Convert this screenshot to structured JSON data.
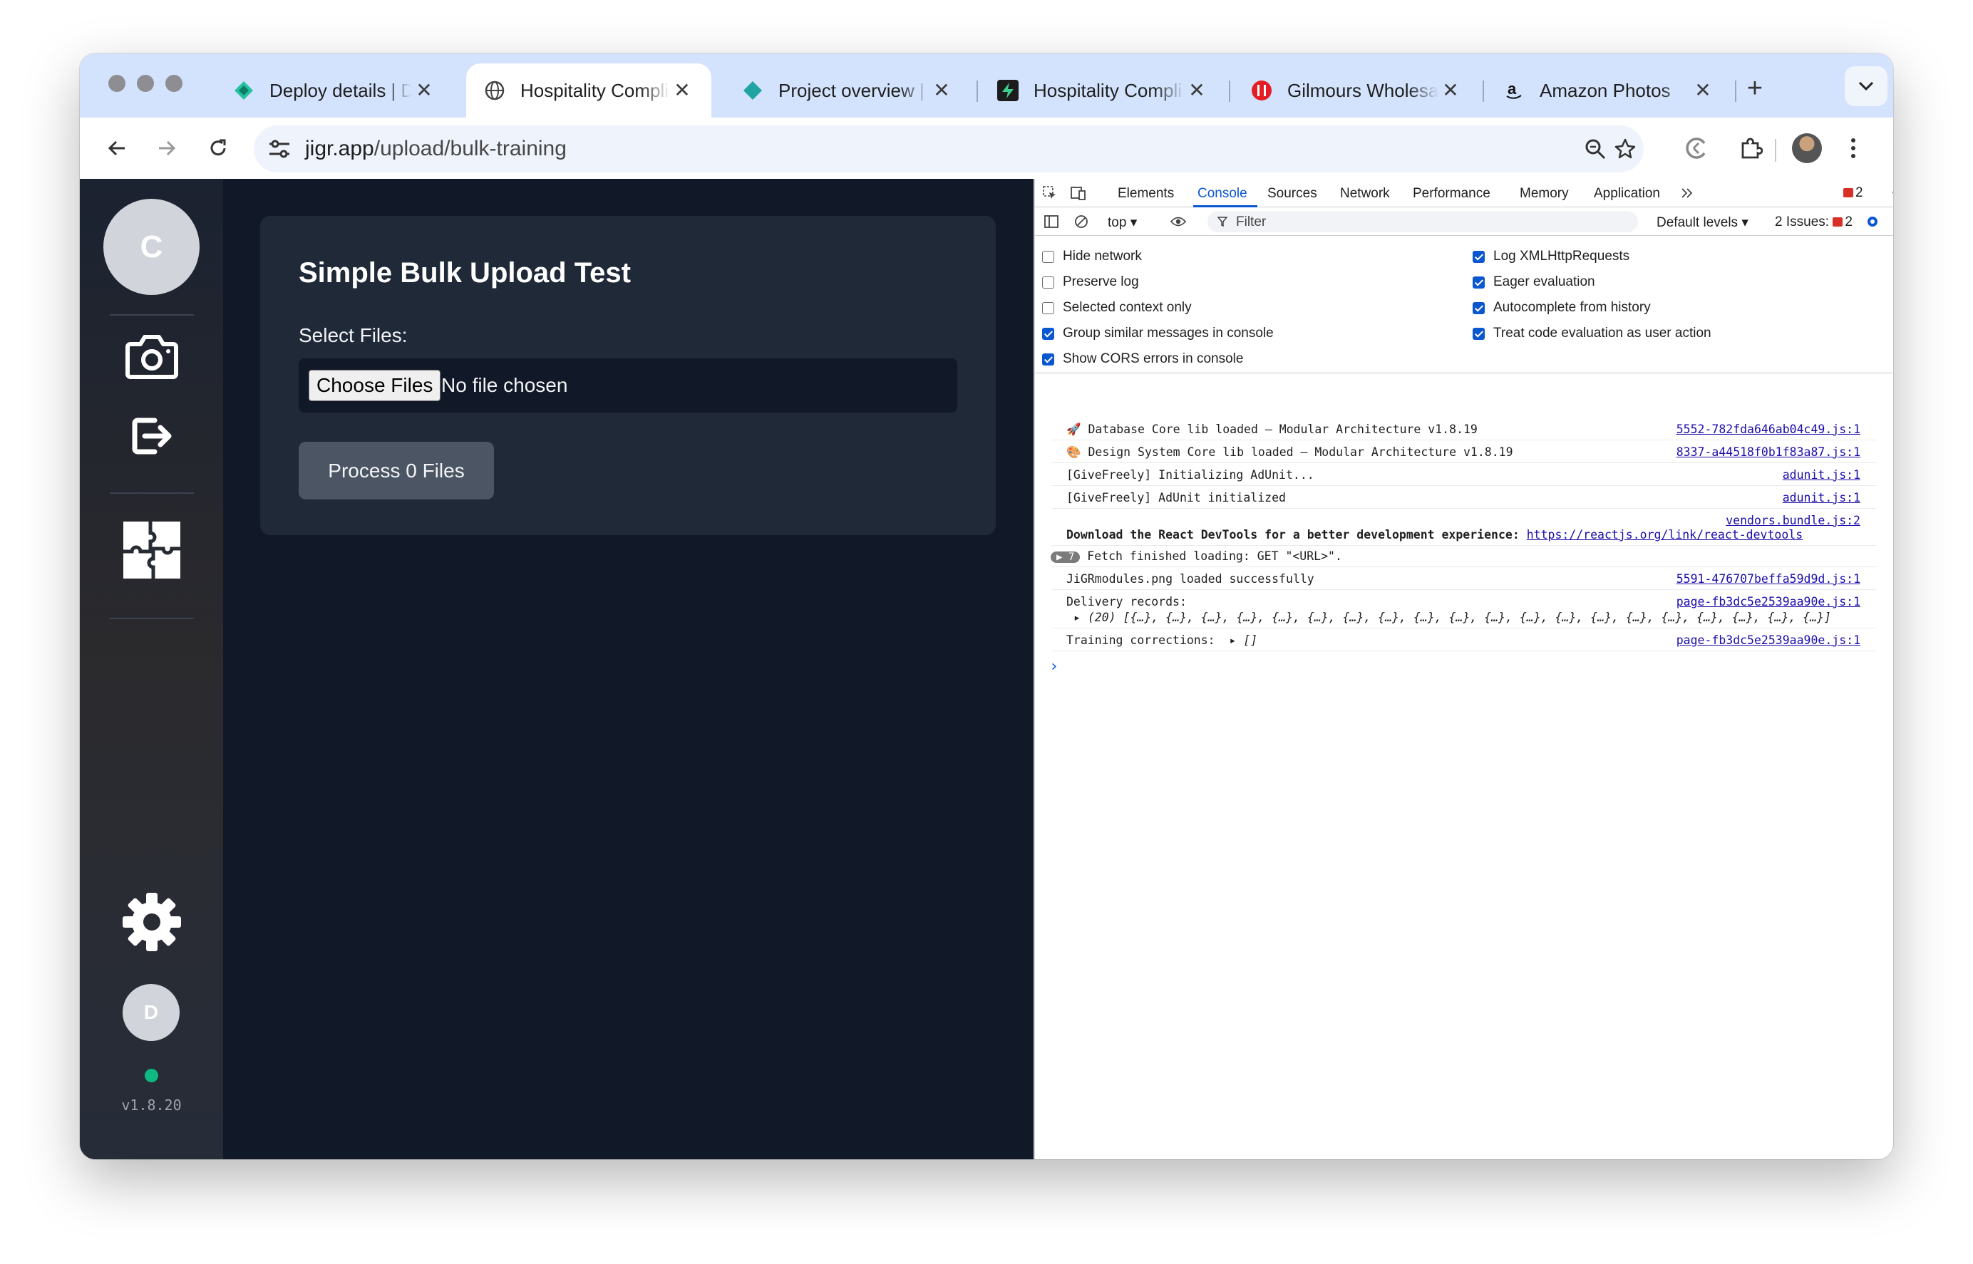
{
  "browser": {
    "tabs": [
      {
        "title": "Deploy details | De",
        "favicon": "netlify-icon"
      },
      {
        "title": "Hospitality Compli",
        "favicon": "globe-icon",
        "active": true
      },
      {
        "title": "Project overview | ",
        "favicon": "diamond-icon"
      },
      {
        "title": "Hospitality Compli",
        "favicon": "supabase-icon"
      },
      {
        "title": "Gilmours Wholesal",
        "favicon": "gilmours-icon"
      },
      {
        "title": "Amazon Photos",
        "favicon": "amazon-icon"
      }
    ],
    "url_host": "jigr.app",
    "url_path": "/upload/bulk-training"
  },
  "sidebar": {
    "avatar_initial": "C",
    "user_initial": "D",
    "version": "v1.8.20",
    "icons": [
      "camera-icon",
      "logout-icon",
      "puzzle-icon",
      "gear-icon"
    ],
    "status_color": "#10b981"
  },
  "main": {
    "title": "Simple Bulk Upload Test",
    "select_label": "Select Files:",
    "choose_button": "Choose Files",
    "no_file": "No file chosen",
    "process_button": "Process 0 Files"
  },
  "devtools": {
    "tabs": [
      "Elements",
      "Console",
      "Sources",
      "Network",
      "Performance",
      "Memory",
      "Application"
    ],
    "active_tab": "Console",
    "error_count": "2",
    "context": "top",
    "filter_placeholder": "Filter",
    "levels": "Default levels",
    "issues_label": "2 Issues:",
    "issues_count": "2",
    "options_left": [
      {
        "label": "Hide network",
        "checked": false
      },
      {
        "label": "Preserve log",
        "checked": false
      },
      {
        "label": "Selected context only",
        "checked": false
      },
      {
        "label": "Group similar messages in console",
        "checked": true
      },
      {
        "label": "Show CORS errors in console",
        "checked": true
      }
    ],
    "options_right": [
      {
        "label": "Log XMLHttpRequests",
        "checked": true
      },
      {
        "label": "Eager evaluation",
        "checked": true
      },
      {
        "label": "Autocomplete from history",
        "checked": true
      },
      {
        "label": "Treat code evaluation as user action",
        "checked": true
      }
    ],
    "logs": [
      {
        "msg": "🚀 Database Core lib loaded – Modular Architecture v1.8.19",
        "src": "5552-782fda646ab04c49.js:1"
      },
      {
        "msg": "🎨 Design System Core lib loaded – Modular Architecture v1.8.19",
        "src": "8337-a44518f0b1f83a87.js:1"
      },
      {
        "msg": "[GiveFreely] Initializing AdUnit...",
        "src": "adunit.js:1"
      },
      {
        "msg": "[GiveFreely] AdUnit initialized",
        "src": "adunit.js:1"
      }
    ],
    "react_src": "vendors.bundle.js:2",
    "react_msg": "Download the React DevTools for a better development experience: ",
    "react_link": "https://reactjs.org/link/react-devtools",
    "fetch_count": "7",
    "fetch_msg": "Fetch finished loading: GET \"<URL>\".",
    "jigr_msg": "JiGRmodules.png loaded successfully",
    "jigr_src": "5591-476707beffa59d9d.js:1",
    "delivery_msg": "Delivery records:",
    "delivery_src": "page-fb3dc5e2539aa90e.js:1",
    "delivery_array": "▸ (20) [{…}, {…}, {…}, {…}, {…}, {…}, {…}, {…}, {…}, {…}, {…}, {…}, {…}, {…}, {…}, {…}, {…}, {…}, {…}, {…}]",
    "training_msg": "Training corrections:",
    "training_val": "▸ []",
    "training_src": "page-fb3dc5e2539aa90e.js:1"
  }
}
